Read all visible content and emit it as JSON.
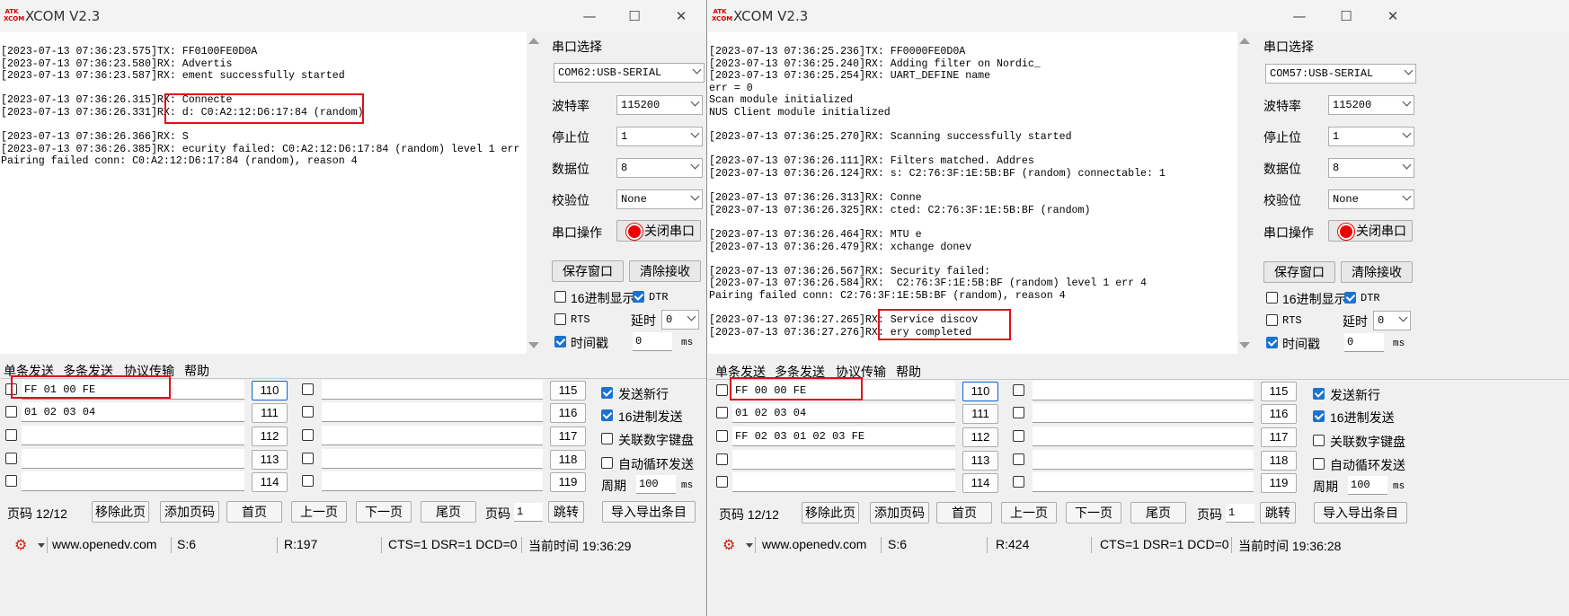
{
  "app": {
    "logo_text": "ATK XCOM",
    "title": "XCOM V2.3"
  },
  "window_controls": {
    "minimize": "—",
    "maximize": "☐",
    "close": "✕"
  },
  "colors": {
    "highlight": "#e0101a",
    "check_blue": "#1a73d0",
    "record_red": "#e00000"
  },
  "left": {
    "log": [
      "[2023-07-13 07:36:23.575]TX: FF0100FE0D0A",
      "[2023-07-13 07:36:23.580]RX: Advertis",
      "[2023-07-13 07:36:23.587]RX: ement successfully started",
      "",
      "[2023-07-13 07:36:26.315]RX: Connecte",
      "[2023-07-13 07:36:26.331]RX: d: C0:A2:12:D6:17:84 (random)",
      "",
      "[2023-07-13 07:36:26.366]RX: S",
      "[2023-07-13 07:36:26.385]RX: ecurity failed: C0:A2:12:D6:17:84 (random) level 1 err 4",
      "Pairing failed conn: C0:A2:12:D6:17:84 (random), reason 4"
    ],
    "settings": {
      "port_label": "串口选择",
      "port_value": "COM62:USB-SERIAL",
      "baud_label": "波特率",
      "baud_value": "115200",
      "stop_label": "停止位",
      "stop_value": "1",
      "data_label": "数据位",
      "data_value": "8",
      "parity_label": "校验位",
      "parity_value": "None",
      "op_label": "串口操作",
      "op_button": "关闭串口",
      "save_button": "保存窗口",
      "clear_button": "清除接收",
      "hex_display": "16进制显示",
      "dtr": "DTR",
      "rts": "RTS",
      "delay_label": "延时",
      "delay_value": "0",
      "delay_unit": "ms",
      "timestamp": "时间戳",
      "timestamp_value": "0",
      "timestamp_unit": "ms"
    },
    "tabs": [
      "单条发送",
      "多条发送",
      "协议传输",
      "帮助"
    ],
    "rows_a": [
      {
        "text": "FF 01 00 FE",
        "num": "110"
      },
      {
        "text": "01 02 03 04",
        "num": "111"
      },
      {
        "text": "",
        "num": "112"
      },
      {
        "text": "",
        "num": "113"
      },
      {
        "text": "",
        "num": "114"
      }
    ],
    "rows_b": [
      {
        "text": "",
        "num": "115"
      },
      {
        "text": "",
        "num": "116"
      },
      {
        "text": "",
        "num": "117"
      },
      {
        "text": "",
        "num": "118"
      },
      {
        "text": "",
        "num": "119"
      }
    ],
    "opts": {
      "newline": "发送新行",
      "hex_send": "16进制发送",
      "numpad": "关联数字键盘",
      "loop": "自动循环发送",
      "period_label": "周期",
      "period_value": "100",
      "period_unit": "ms"
    },
    "pager": {
      "page_label": "页码 12/12",
      "remove": "移除此页",
      "add": "添加页码",
      "first": "首页",
      "prev": "上一页",
      "next": "下一页",
      "last": "尾页",
      "page_code_label": "页码",
      "page_code_value": "1",
      "jump": "跳转",
      "import_export": "导入导出条目"
    },
    "status": {
      "url": "www.openedv.com",
      "s": "S:6",
      "r": "R:197",
      "lines": "CTS=1 DSR=1 DCD=0",
      "time": "当前时间 19:36:29"
    }
  },
  "right": {
    "log": [
      "[2023-07-13 07:36:25.236]TX: FF0000FE0D0A",
      "[2023-07-13 07:36:25.240]RX: Adding filter on Nordic_",
      "[2023-07-13 07:36:25.254]RX: UART_DEFINE name",
      "err = 0",
      "Scan module initialized",
      "NUS Client module initialized",
      "",
      "[2023-07-13 07:36:25.270]RX: Scanning successfully started",
      "",
      "[2023-07-13 07:36:26.111]RX: Filters matched. Addres",
      "[2023-07-13 07:36:26.124]RX: s: C2:76:3F:1E:5B:BF (random) connectable: 1",
      "",
      "[2023-07-13 07:36:26.313]RX: Conne",
      "[2023-07-13 07:36:26.325]RX: cted: C2:76:3F:1E:5B:BF (random)",
      "",
      "[2023-07-13 07:36:26.464]RX: MTU e",
      "[2023-07-13 07:36:26.479]RX: xchange donev",
      "",
      "[2023-07-13 07:36:26.567]RX: Security failed:",
      "[2023-07-13 07:36:26.584]RX:  C2:76:3F:1E:5B:BF (random) level 1 err 4",
      "Pairing failed conn: C2:76:3F:1E:5B:BF (random), reason 4",
      "",
      "[2023-07-13 07:36:27.265]RX: Service discov",
      "[2023-07-13 07:36:27.276]RX: ery completed"
    ],
    "settings": {
      "port_label": "串口选择",
      "port_value": "COM57:USB-SERIAL",
      "baud_label": "波特率",
      "baud_value": "115200",
      "stop_label": "停止位",
      "stop_value": "1",
      "data_label": "数据位",
      "data_value": "8",
      "parity_label": "校验位",
      "parity_value": "None",
      "op_label": "串口操作",
      "op_button": "关闭串口",
      "save_button": "保存窗口",
      "clear_button": "清除接收",
      "hex_display": "16进制显示",
      "dtr": "DTR",
      "rts": "RTS",
      "delay_label": "延时",
      "delay_value": "0",
      "delay_unit": "ms",
      "timestamp": "时间戳",
      "timestamp_value": "0",
      "timestamp_unit": "ms"
    },
    "tabs": [
      "单条发送",
      "多条发送",
      "协议传输",
      "帮助"
    ],
    "rows_a": [
      {
        "text": "FF 00 00 FE",
        "num": "110"
      },
      {
        "text": "01 02 03 04",
        "num": "111"
      },
      {
        "text": "FF 02 03 01 02 03 FE",
        "num": "112"
      },
      {
        "text": "",
        "num": "113"
      },
      {
        "text": "",
        "num": "114"
      }
    ],
    "rows_b": [
      {
        "text": "",
        "num": "115"
      },
      {
        "text": "",
        "num": "116"
      },
      {
        "text": "",
        "num": "117"
      },
      {
        "text": "",
        "num": "118"
      },
      {
        "text": "",
        "num": "119"
      }
    ],
    "opts": {
      "newline": "发送新行",
      "hex_send": "16进制发送",
      "numpad": "关联数字键盘",
      "loop": "自动循环发送",
      "period_label": "周期",
      "period_value": "100",
      "period_unit": "ms"
    },
    "pager": {
      "page_label": "页码 12/12",
      "remove": "移除此页",
      "add": "添加页码",
      "first": "首页",
      "prev": "上一页",
      "next": "下一页",
      "last": "尾页",
      "page_code_label": "页码",
      "page_code_value": "1",
      "jump": "跳转",
      "import_export": "导入导出条目"
    },
    "status": {
      "url": "www.openedv.com",
      "s": "S:6",
      "r": "R:424",
      "lines": "CTS=1 DSR=1 DCD=0",
      "time": "当前时间 19:36:28"
    }
  }
}
